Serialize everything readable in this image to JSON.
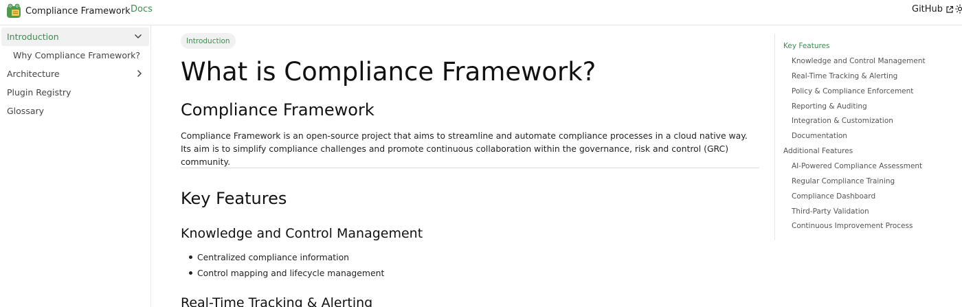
{
  "header": {
    "brand": "Compliance Framework",
    "nav_docs": "Docs",
    "github": "GitHub"
  },
  "sidebar": {
    "items": [
      {
        "label": "Introduction"
      },
      {
        "label": "Why Compliance Framework?"
      },
      {
        "label": "Architecture"
      },
      {
        "label": "Plugin Registry"
      },
      {
        "label": "Glossary"
      }
    ]
  },
  "main": {
    "badge": "Introduction",
    "title": "What is Compliance Framework?",
    "section_title": "Compliance Framework",
    "intro": "Compliance Framework is an open-source project that aims to streamline and automate compliance processes in a cloud native way. Its aim is to simplify compliance challenges and promote continuous collaboration within the governance, risk and control (GRC) community.",
    "key_features_title": "Key Features",
    "knowledge_title": "Knowledge and Control Management",
    "knowledge_bullets": [
      "Centralized compliance information",
      "Control mapping and lifecycle management"
    ],
    "realtime_title": "Real-Time Tracking & Alerting"
  },
  "toc": {
    "items": [
      {
        "label": "Key Features"
      },
      {
        "label": "Knowledge and Control Management"
      },
      {
        "label": "Real-Time Tracking & Alerting"
      },
      {
        "label": "Policy & Compliance Enforcement"
      },
      {
        "label": "Reporting & Auditing"
      },
      {
        "label": "Integration & Customization"
      },
      {
        "label": "Documentation"
      },
      {
        "label": "Additional Features"
      },
      {
        "label": "AI-Powered Compliance Assessment"
      },
      {
        "label": "Regular Compliance Training"
      },
      {
        "label": "Compliance Dashboard"
      },
      {
        "label": "Third-Party Validation"
      },
      {
        "label": "Continuous Improvement Process"
      }
    ]
  },
  "colors": {
    "accent": "#3f8a52",
    "text": "#1c1c1c",
    "border": "#e6e6e6"
  },
  "icons": {
    "logo": "frog-logo-icon",
    "external": "external-link-icon",
    "theme": "sun-icon",
    "expand": "chevron-down-icon",
    "collapse": "chevron-right-icon"
  }
}
